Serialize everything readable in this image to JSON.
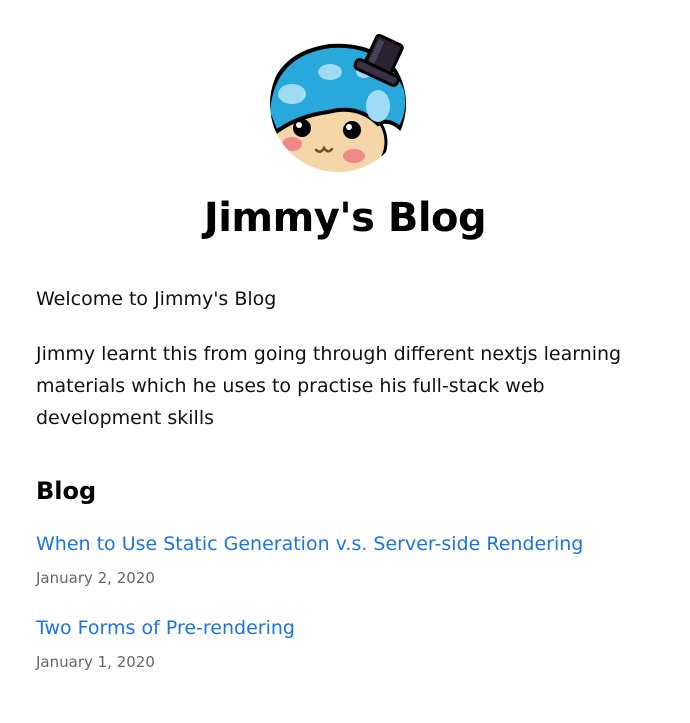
{
  "site": {
    "title": "Jimmy's Blog",
    "avatar_icon": "mushroom-avatar-with-top-hat"
  },
  "intro": {
    "welcome": "Welcome to Jimmy's Blog",
    "description": "Jimmy learnt this from going through different nextjs learning materials which he uses to practise his full-stack web development skills"
  },
  "blog": {
    "heading": "Blog",
    "posts": [
      {
        "title": "When to Use Static Generation v.s. Server-side Rendering",
        "date": "January 2, 2020"
      },
      {
        "title": "Two Forms of Pre-rendering",
        "date": "January 1, 2020"
      }
    ]
  },
  "colors": {
    "link": "#1a73e8",
    "date": "#666666",
    "text": "#111111"
  }
}
